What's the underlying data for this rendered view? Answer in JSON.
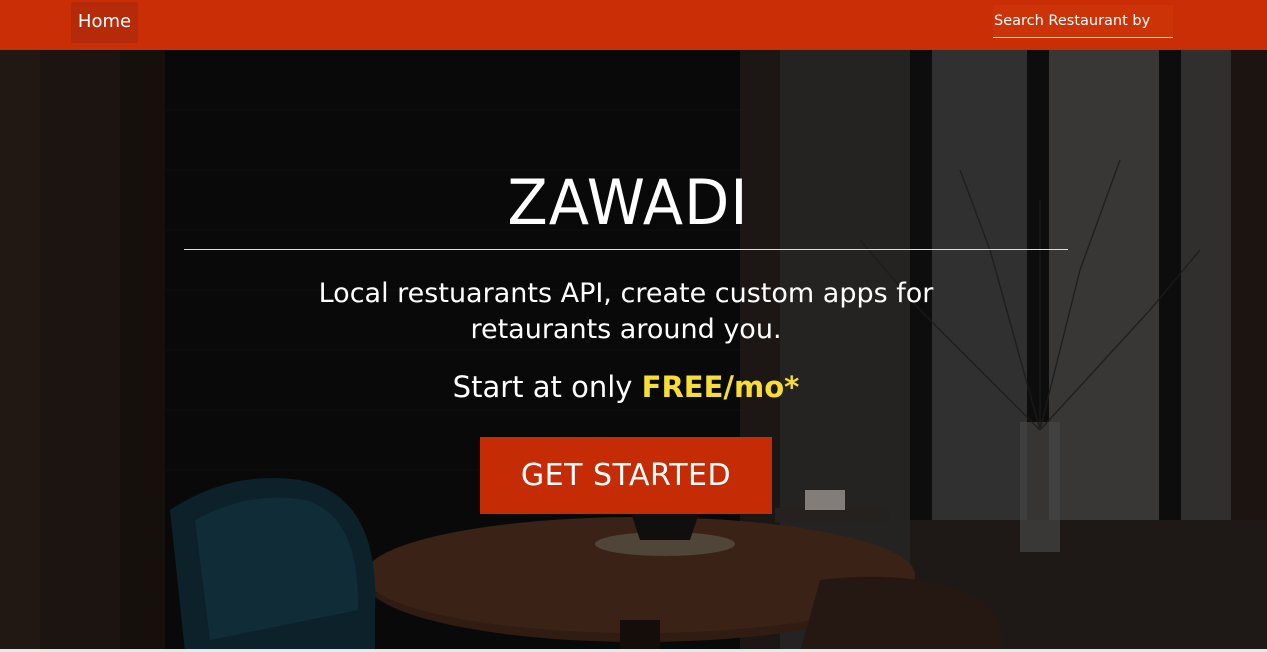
{
  "navbar": {
    "home_label": "Home",
    "search_label": "Search Restaurant by"
  },
  "hero": {
    "title": "ZAWADI",
    "subtitle": "Local restuarants API, create custom apps for retaurants around you.",
    "price_prefix": "Start at only",
    "price_value": "FREE/mo*",
    "cta_label": "GET STARTED"
  },
  "colors": {
    "brand": "#c92e06",
    "accent": "#f6de34"
  }
}
